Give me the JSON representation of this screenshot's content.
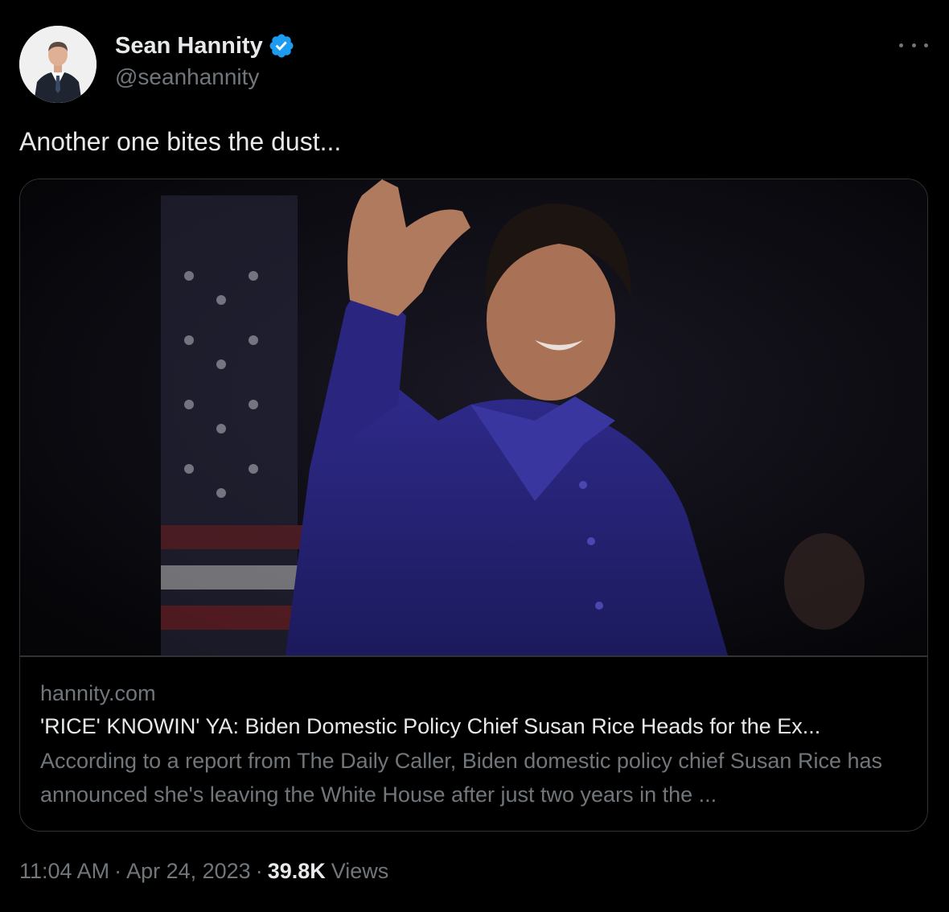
{
  "author": {
    "display_name": "Sean Hannity",
    "handle": "@seanhannity",
    "verified": true
  },
  "tweet": {
    "text": "Another one bites the dust..."
  },
  "card": {
    "domain": "hannity.com",
    "title": "'RICE' KNOWIN' YA: Biden Domestic Policy Chief Susan Rice Heads for the Ex...",
    "description": "According to a report from The Daily Caller, Biden domestic policy chief Susan Rice has announced she's leaving the White House after just two years in the ..."
  },
  "meta": {
    "time": "11:04 AM",
    "separator": "·",
    "date": "Apr 24, 2023",
    "views_count": "39.8K",
    "views_label": "Views"
  },
  "icons": {
    "verified": "verified-badge-icon",
    "more": "more-options-icon"
  },
  "colors": {
    "background": "#000000",
    "text_primary": "#e7e9ea",
    "text_secondary": "#71767b",
    "border": "#2f3336",
    "verified_blue": "#1d9bf0"
  }
}
